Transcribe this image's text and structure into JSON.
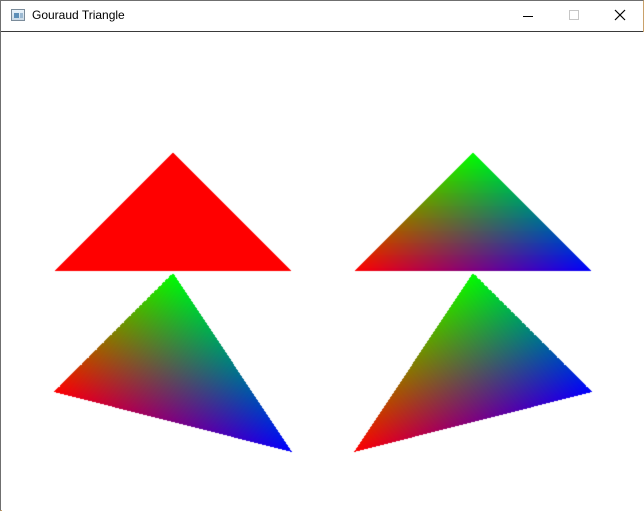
{
  "window": {
    "title": "Gouraud Triangle",
    "icon": "app-window-icon",
    "controls": {
      "minimize_icon": "minimize-icon",
      "maximize_icon": "maximize-icon",
      "close_icon": "close-icon"
    }
  },
  "scene": {
    "background": "#ffffff",
    "triangles": [
      {
        "name": "flat-red-triangle",
        "shading": "flat",
        "colors": [
          "#ff0000",
          "#ff0000",
          "#ff0000"
        ]
      },
      {
        "name": "gouraud-triangle-top-right",
        "shading": "gouraud",
        "colors": [
          "#00ff00",
          "#ff0000",
          "#0000ff"
        ]
      },
      {
        "name": "gouraud-triangle-bottom-left",
        "shading": "gouraud",
        "colors": [
          "#00ff00",
          "#ff0000",
          "#0000ff"
        ]
      },
      {
        "name": "gouraud-triangle-bottom-right",
        "shading": "gouraud",
        "colors": [
          "#00ff00",
          "#0000ff",
          "#ff0000"
        ]
      }
    ]
  }
}
